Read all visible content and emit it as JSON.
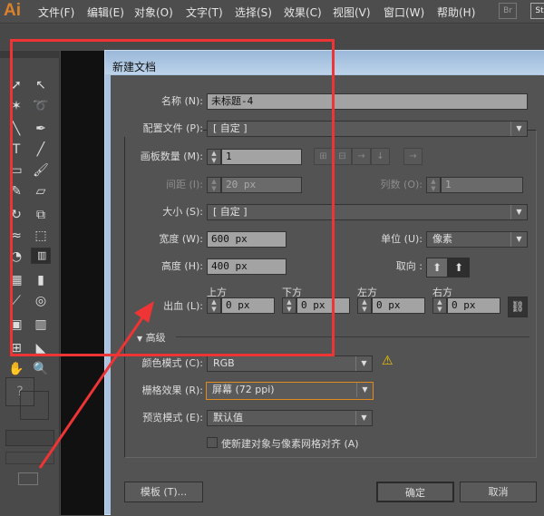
{
  "app": {
    "logo": "Ai",
    "menus": [
      "文件(F)",
      "编辑(E)",
      "对象(O)",
      "文字(T)",
      "选择(S)",
      "效果(C)",
      "视图(V)",
      "窗口(W)",
      "帮助(H)"
    ],
    "badges": [
      "Br",
      "St"
    ]
  },
  "toolbar": {
    "tools": [
      [
        "selection-tool",
        "➚"
      ],
      [
        "direct-selection-tool",
        "↖"
      ],
      [
        "magic-wand-tool",
        "✶"
      ],
      [
        "lasso-tool",
        "➰"
      ],
      [
        "pen-tool",
        "╲"
      ],
      [
        "curvature-tool",
        "✒"
      ],
      [
        "type-tool",
        "T"
      ],
      [
        "line-tool",
        "╱"
      ],
      [
        "rectangle-tool",
        "▭"
      ],
      [
        "paintbrush-tool",
        "🖌"
      ],
      [
        "pencil-tool",
        "✎"
      ],
      [
        "eraser-tool",
        "▱"
      ],
      [
        "rotate-tool",
        "↻"
      ],
      [
        "scale-tool",
        "⧉"
      ],
      [
        "warp-tool",
        "≈"
      ],
      [
        "free-transform-tool",
        "⬚"
      ],
      [
        "shape-builder-tool",
        "◔"
      ],
      [
        "perspective-grid-tool",
        "▥"
      ],
      [
        "mesh-tool",
        "▦"
      ],
      [
        "gradient-tool",
        "▮"
      ],
      [
        "eyedropper-tool",
        "⟋"
      ],
      [
        "blend-tool",
        "◎"
      ],
      [
        "symbol-sprayer-tool",
        "▣"
      ],
      [
        "column-graph-tool",
        "▥"
      ],
      [
        "artboard-tool",
        "⊞"
      ],
      [
        "slice-tool",
        "◣"
      ],
      [
        "hand-tool",
        "✋"
      ],
      [
        "zoom-tool",
        "🔍"
      ]
    ],
    "fill_stroke_unknown": "?"
  },
  "dialog": {
    "title": "新建文档",
    "name": {
      "label": "名称 (N):",
      "value": "未标题-4"
    },
    "profile": {
      "label": "配置文件 (P):",
      "value": "[ 自定 ]"
    },
    "artboards": {
      "label": "画板数量 (M):",
      "value": "1"
    },
    "spacing": {
      "label": "间距 (I):",
      "value": "20 px"
    },
    "columns": {
      "label": "列数 (O):",
      "value": "1"
    },
    "size": {
      "label": "大小 (S):",
      "value": "[ 自定 ]"
    },
    "width": {
      "label": "宽度 (W):",
      "value": "600 px"
    },
    "units": {
      "label": "单位 (U):",
      "value": "像素"
    },
    "height": {
      "label": "高度 (H):",
      "value": "400 px"
    },
    "orientation": {
      "label": "取向 :"
    },
    "bleed": {
      "label": "出血 (L):",
      "fields": [
        {
          "label": "上方",
          "value": "0 px"
        },
        {
          "label": "下方",
          "value": "0 px"
        },
        {
          "label": "左方",
          "value": "0 px"
        },
        {
          "label": "右方",
          "value": "0 px"
        }
      ]
    },
    "advanced": {
      "label": "高级"
    },
    "color_mode": {
      "label": "颜色模式 (C):",
      "value": "RGB"
    },
    "raster": {
      "label": "栅格效果 (R):",
      "value": "屏幕 (72 ppi)"
    },
    "preview": {
      "label": "预览模式 (E):",
      "value": "默认值"
    },
    "align_pixel": {
      "label": "使新建对象与像素网格对齐 (A)",
      "checked": false
    },
    "buttons": {
      "template": "模板 (T)...",
      "ok": "确定",
      "cancel": "取消"
    }
  },
  "colors": {
    "annotation": "#ee3434",
    "focus": "#e08a1e",
    "warning": "#f2c500"
  }
}
